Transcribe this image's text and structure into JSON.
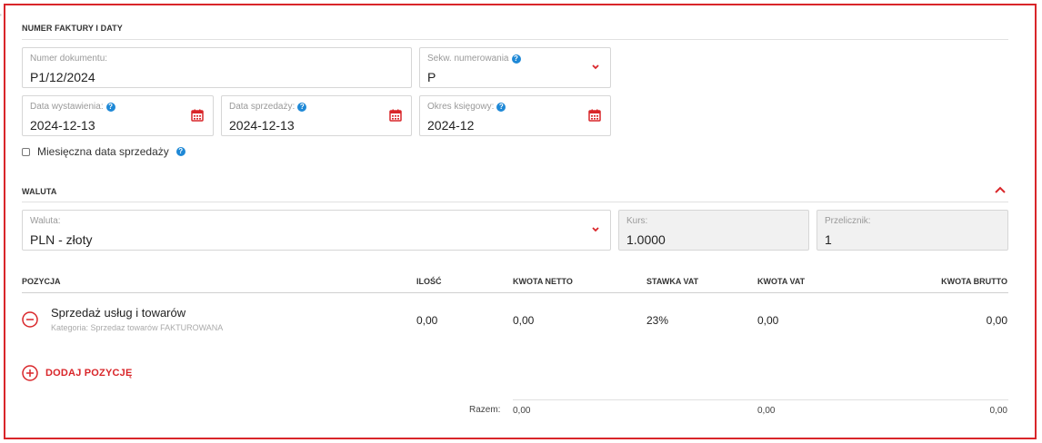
{
  "invoice": {
    "section_title": "NUMER FAKTURY I DATY",
    "document_number": {
      "label": "Numer dokumentu:",
      "value": "P1/12/2024"
    },
    "sequence": {
      "label": "Sekw. numerowania",
      "value": "P"
    },
    "issue_date": {
      "label": "Data wystawienia:",
      "value": "2024-12-13"
    },
    "sale_date": {
      "label": "Data sprzedaży:",
      "value": "2024-12-13"
    },
    "accounting_period": {
      "label": "Okres księgowy:",
      "value": "2024-12"
    },
    "monthly_sale_label": "Miesięczna data sprzedaży"
  },
  "currency": {
    "section_title": "WALUTA",
    "currency_field": {
      "label": "Waluta:",
      "value": "PLN - złoty"
    },
    "rate": {
      "label": "Kurs:",
      "value": "1.0000"
    },
    "multiplier": {
      "label": "Przelicznik:",
      "value": "1"
    }
  },
  "positions": {
    "headers": {
      "position": "POZYCJA",
      "qty": "ILOŚĆ",
      "net": "KWOTA NETTO",
      "vat_rate": "STAWKA VAT",
      "vat": "KWOTA VAT",
      "gross": "KWOTA BRUTTO"
    },
    "rows": [
      {
        "name": "Sprzedaż usług i towarów",
        "category": "Kategoria: Sprzedaz towarów FAKTUROWANA",
        "qty": "0,00",
        "net": "0,00",
        "vat_rate": "23%",
        "vat": "0,00",
        "gross": "0,00"
      }
    ],
    "add_label": "DODAJ POZYCJĘ",
    "totals": {
      "label": "Razem:",
      "net": "0,00",
      "vat": "0,00",
      "gross": "0,00"
    }
  },
  "colors": {
    "accent": "#d9262a",
    "help": "#1e88d6",
    "border": "#d6d6d6"
  },
  "icons": [
    "help-icon",
    "chevron-down-icon",
    "calendar-icon",
    "chevron-up-icon",
    "minus-circle-icon",
    "plus-circle-icon"
  ]
}
